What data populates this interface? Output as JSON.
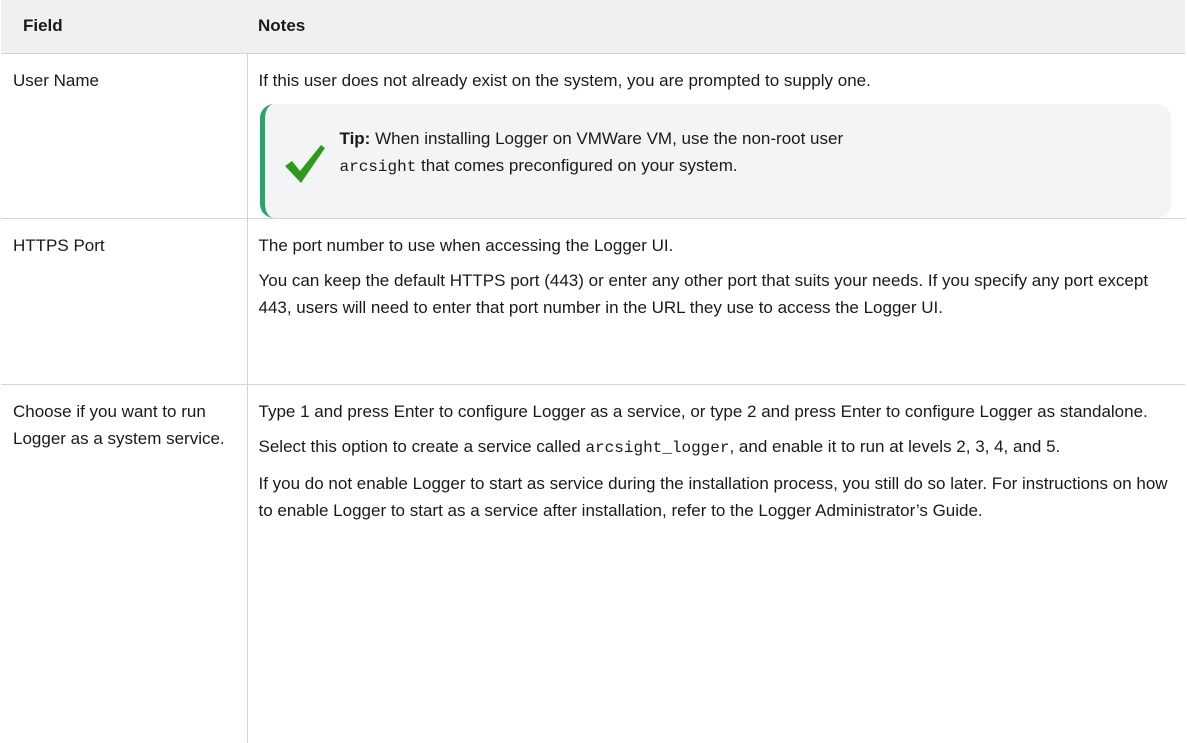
{
  "table": {
    "headers": {
      "field": "Field",
      "notes": "Notes"
    },
    "rows": [
      {
        "field": "User Name",
        "notes": [
          "If this user does not already exist on the system, you are prompted to supply one."
        ],
        "tip": {
          "icon": "checkmark-icon",
          "label": "Tip:",
          "text_before": " When installing Logger on VMWare VM, use the non-root user",
          "code": "arcsight",
          "text_after": " that comes preconfigured on your system."
        }
      },
      {
        "field": "HTTPS Port",
        "notes": [
          "The port number to use when accessing the Logger UI.",
          "You can keep the default HTTPS port (443) or enter any other port that suits your needs. If you specify any port except 443, users will need to enter that port number in the URL they use to access the Logger UI."
        ]
      },
      {
        "field": "Choose if you want to run Logger as a system service.",
        "notes_p1": "Type 1 and press Enter to configure Logger as a service, or type 2 and press Enter to configure Logger as standalone.",
        "notes_p2": {
          "before": "Select this option to create a service called ",
          "code": "arcsight_logger",
          "after": ", and enable it to run at levels 2, 3, 4, and 5."
        },
        "notes_p3": "If you do not enable Logger to start as service during the installation process, you still do so later. For instructions on how to enable Logger to start as a service after installation, refer to the Logger Administrator’s Guide."
      }
    ]
  },
  "colors": {
    "header_bg": "#f0f0f0",
    "tip_bg": "#f3f4f6",
    "tip_accent": "#29a46a",
    "check_green": "#2e9a1c"
  }
}
